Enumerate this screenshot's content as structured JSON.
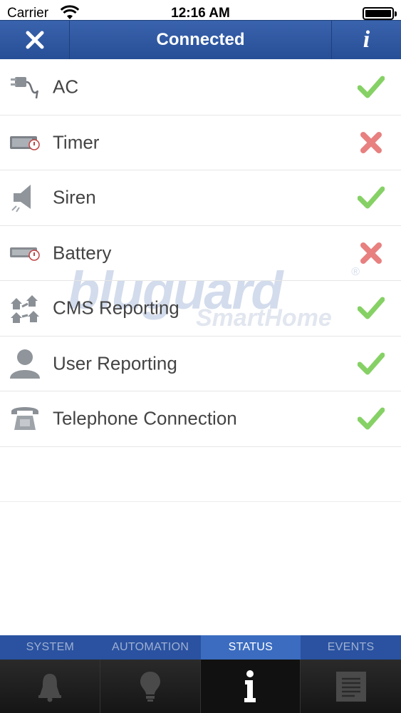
{
  "status_bar": {
    "carrier": "Carrier",
    "time": "12:16 AM"
  },
  "nav": {
    "title": "Connected",
    "info_label": "i"
  },
  "items": [
    {
      "label": "AC",
      "icon": "plug-icon",
      "status": "ok"
    },
    {
      "label": "Timer",
      "icon": "timer-icon",
      "status": "fail"
    },
    {
      "label": "Siren",
      "icon": "siren-icon",
      "status": "ok"
    },
    {
      "label": "Battery",
      "icon": "battery-icon",
      "status": "fail"
    },
    {
      "label": "CMS Reporting",
      "icon": "cms-reporting-icon",
      "status": "ok"
    },
    {
      "label": "User Reporting",
      "icon": "user-icon",
      "status": "ok"
    },
    {
      "label": "Telephone Connection",
      "icon": "telephone-icon",
      "status": "ok"
    }
  ],
  "watermark": {
    "brand": "bluguard",
    "sub": "SmartHome",
    "mark": "®"
  },
  "tabs": [
    {
      "label": "SYSTEM",
      "icon": "bell-icon",
      "active": false
    },
    {
      "label": "AUTOMATION",
      "icon": "lightbulb-icon",
      "active": false
    },
    {
      "label": "STATUS",
      "icon": "info-icon",
      "active": true
    },
    {
      "label": "EVENTS",
      "icon": "list-icon",
      "active": false
    }
  ],
  "colors": {
    "nav": "#2f58a3",
    "ok": "#7fcf5a",
    "fail": "#e57b7b"
  }
}
